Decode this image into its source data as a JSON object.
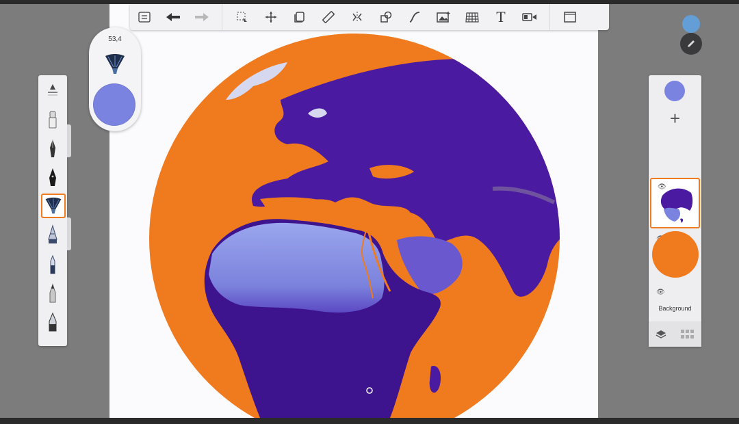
{
  "app": {
    "brush_size_value": "53,4",
    "colors": {
      "active_color": "#7a84e0",
      "selection_accent": "#f07a1e",
      "globe_orange": "#f07a1e",
      "globe_purple": "#4a1aa0"
    }
  },
  "toolbar": {
    "items": [
      {
        "name": "list-icon"
      },
      {
        "name": "undo-icon"
      },
      {
        "name": "redo-icon"
      },
      {
        "name": "selection-icon"
      },
      {
        "name": "transform-icon"
      },
      {
        "name": "layers-stack-icon"
      },
      {
        "name": "ruler-icon"
      },
      {
        "name": "symmetry-icon"
      },
      {
        "name": "shapes-icon"
      },
      {
        "name": "curve-icon"
      },
      {
        "name": "image-icon"
      },
      {
        "name": "perspective-icon"
      },
      {
        "name": "text-icon"
      },
      {
        "name": "video-icon"
      },
      {
        "name": "fullscreen-icon"
      }
    ]
  },
  "brushes": {
    "items": [
      {
        "name": "brush-properties-icon"
      },
      {
        "name": "eraser-brush-icon"
      },
      {
        "name": "pen-brush-icon"
      },
      {
        "name": "ink-pen-brush-icon"
      },
      {
        "name": "fan-brush-icon",
        "selected": true
      },
      {
        "name": "airbrush-icon"
      },
      {
        "name": "marker-brush-icon"
      },
      {
        "name": "pencil-brush-icon"
      },
      {
        "name": "chisel-brush-icon"
      }
    ]
  },
  "layers": {
    "items": [
      {
        "name": "globe-layer",
        "selected": true
      },
      {
        "name": "orange-circle-layer",
        "selected": false
      },
      {
        "name": "background-layer",
        "label": "Background"
      }
    ]
  }
}
